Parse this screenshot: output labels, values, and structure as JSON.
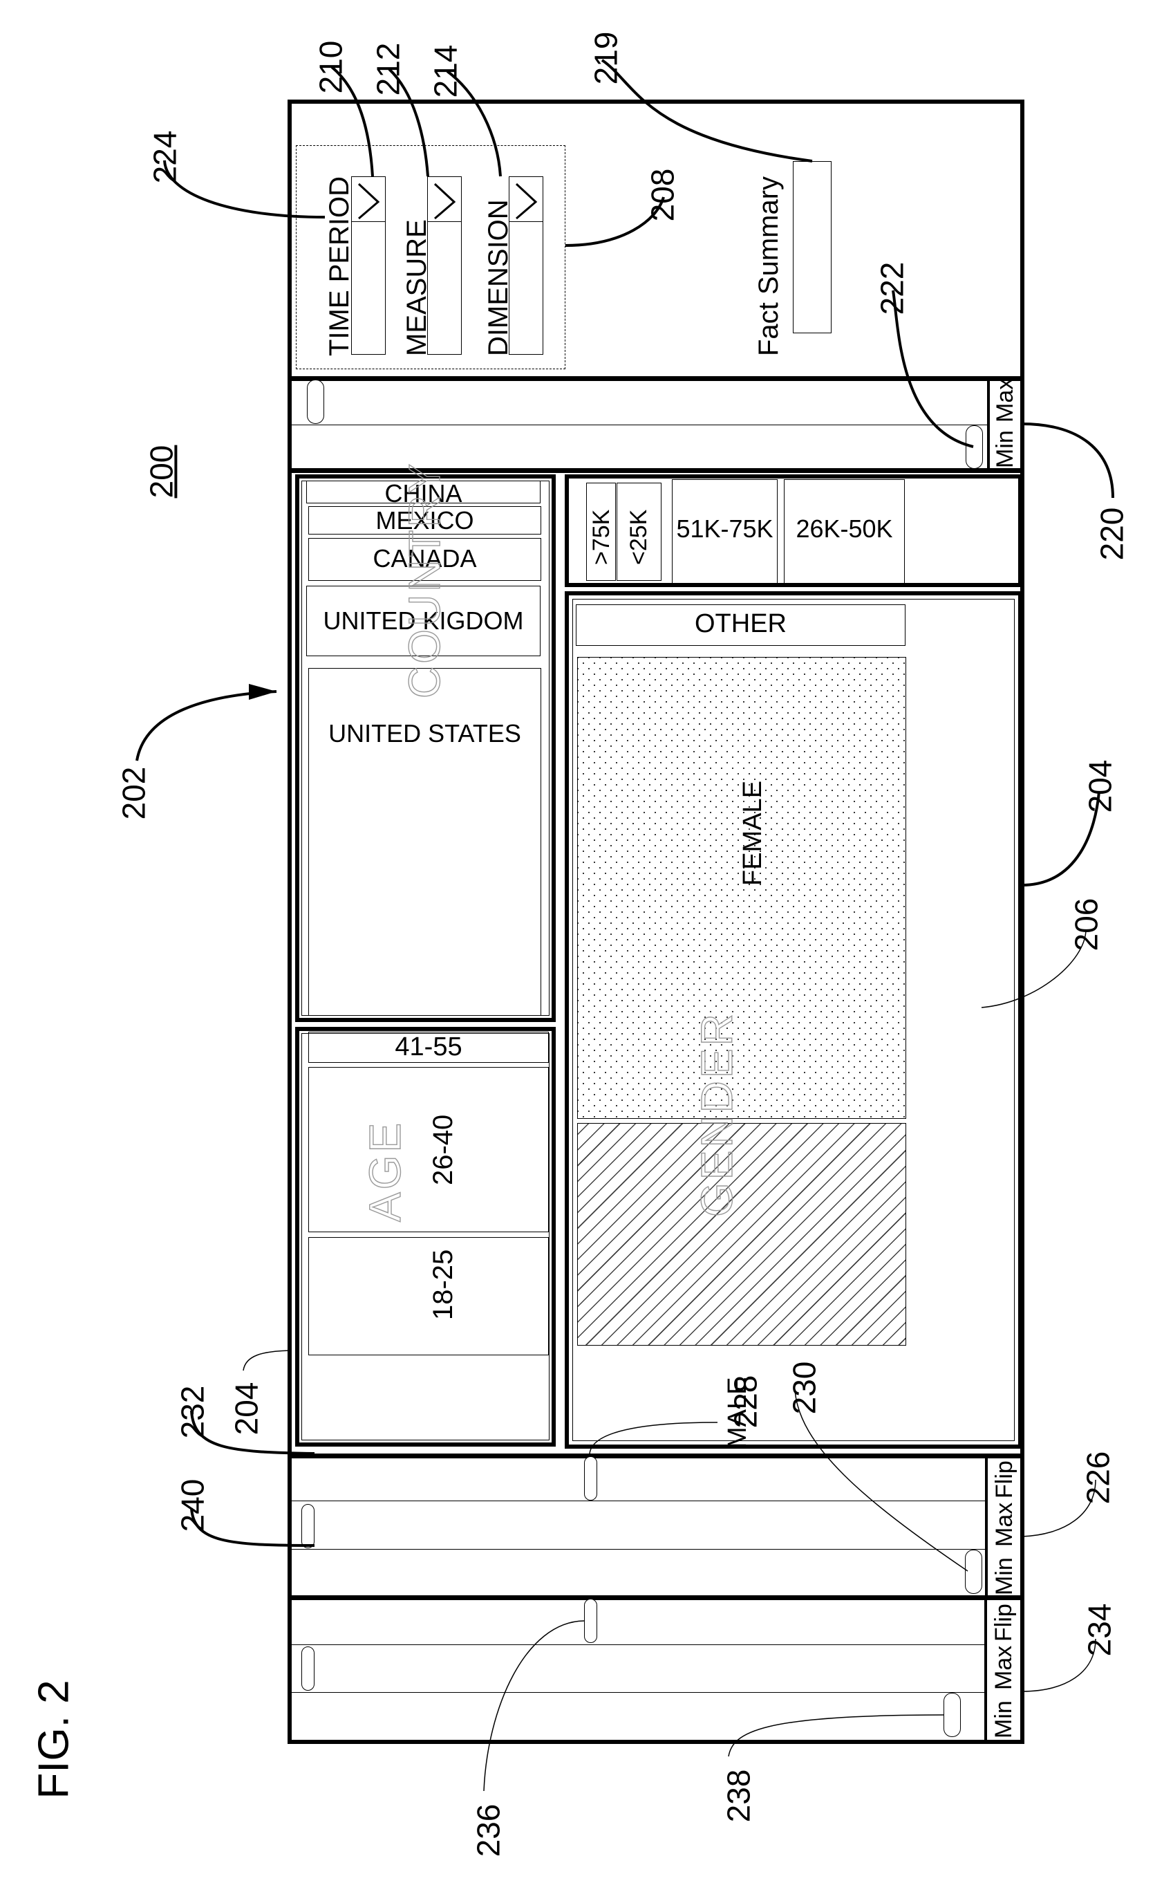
{
  "figure": {
    "title": "FIG. 2",
    "ref_main": "200"
  },
  "controls": {
    "group_ref": "208",
    "dropdowns": [
      {
        "label": "TIME PERIOD",
        "ref": "210",
        "chevron": "chevron-down"
      },
      {
        "label": "MEASURE",
        "ref": "212",
        "chevron": "chevron-down"
      },
      {
        "label": "DIMENSION",
        "ref": "214",
        "chevron": "chevron-down"
      }
    ],
    "fact_summary": {
      "label": "Fact Summary",
      "ref": "219"
    }
  },
  "top_slider": {
    "ref": "224",
    "handle_ref": "222",
    "cell_ref": "220",
    "cell_labels": [
      "Min",
      "Max"
    ]
  },
  "country_panel": {
    "ref": "202",
    "watermark": "COUNTRY",
    "items": [
      "CHINA",
      "MEXICO",
      "CANADA",
      "UNITED KIGDOM",
      "UNITED STATES"
    ]
  },
  "age_panel": {
    "ref": "204",
    "watermark": "AGE",
    "items": [
      "41-55",
      "26-40",
      "18-25"
    ]
  },
  "income_panel": {
    "items": [
      ">75K",
      "<25K",
      "51K-75K",
      "26K-50K"
    ]
  },
  "gender_panel": {
    "ref": "204",
    "region_ref": "206",
    "watermark": "GENDER",
    "items": [
      "OTHER",
      "FEMALE",
      "MALE"
    ]
  },
  "bottom_slider_1": {
    "ref": "226",
    "handle_refs": [
      "228",
      "230",
      "232"
    ],
    "cell_labels": [
      "Min",
      "Max",
      "Flip"
    ]
  },
  "bottom_slider_2": {
    "ref": "234",
    "handle_refs": [
      "236",
      "238",
      "240"
    ],
    "cell_labels": [
      "Min",
      "Max",
      "Flip"
    ]
  }
}
